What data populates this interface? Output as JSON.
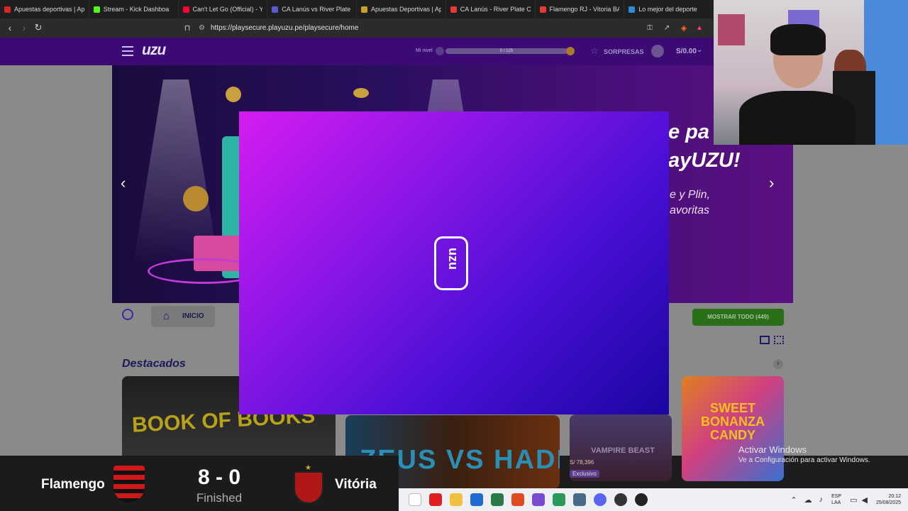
{
  "browser": {
    "tabs": [
      {
        "title": "Apuestas deportivas | Apu",
        "color": "#d82626"
      },
      {
        "title": "Stream - Kick Dashboa",
        "color": "#53fc18"
      },
      {
        "title": "Can't Let Go (Official) - Yo",
        "color": "#ff0033"
      },
      {
        "title": "CA Lanús vs River Plate liv",
        "color": "#5b5bd6"
      },
      {
        "title": "Apuestas Deportivas | Apu",
        "color": "#c9a227"
      },
      {
        "title": "CA Lanús - River Plate Cuo",
        "color": "#e53935"
      },
      {
        "title": "Flamengo RJ - Vitoria BA C",
        "color": "#e53935"
      },
      {
        "title": "Lo mejor del deporte",
        "color": "#2a8bd6"
      }
    ],
    "url": "https://playsecure.playuzu.pe/playsecure/home"
  },
  "site": {
    "logo": "uzu",
    "level_label": "Mi nivel",
    "progress_text": "0 / 125",
    "progress": 0.0,
    "surprises": "SORPRESAS",
    "balance": "S/0.00",
    "banner_line1": "e pa",
    "banner_line2": "ayUZU!",
    "banner_line3": "e y Plin,",
    "banner_line4": "avoritas",
    "home_label": "INICIO",
    "show_all": "MOSTRAR TODO (449)",
    "featured_title": "Destacados",
    "games": [
      {
        "name": "BOOK OF BOOKS"
      },
      {
        "name": "ZEUS VS HADES"
      },
      {
        "name": "VAMPIRE BEAST",
        "price": "S/ 78,396",
        "tag": "Exclusivo"
      },
      {
        "name": "SWEET BONANZA CANDY"
      }
    ]
  },
  "modal": {
    "logo": "uzu"
  },
  "scoreboard": {
    "home": "Flamengo",
    "away": "Vitória",
    "score": "8 - 0",
    "status": "Finished"
  },
  "watermark": {
    "line1": "Activar Windows",
    "line2": "Ve a Configuración para activar Windows."
  },
  "taskbar": {
    "lang1": "ESP",
    "lang2": "LAA",
    "time": "20:12",
    "date": "25/08/2025"
  }
}
